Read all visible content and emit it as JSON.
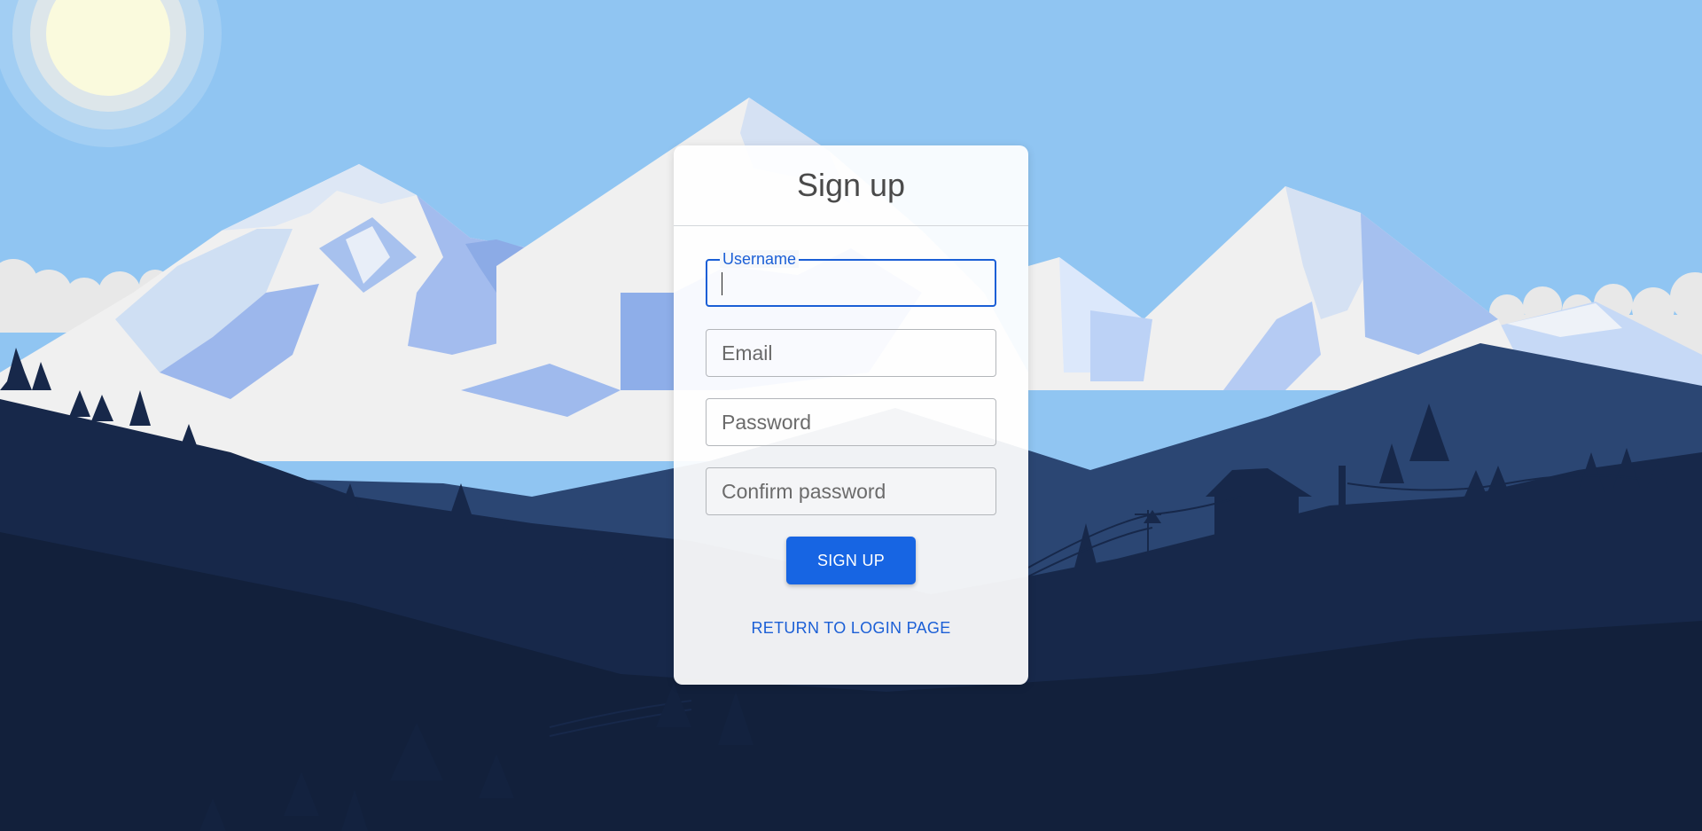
{
  "page": {
    "title": "Sign up"
  },
  "form": {
    "username": {
      "label": "Username",
      "value": "",
      "focused": true
    },
    "email": {
      "placeholder": "Email",
      "value": ""
    },
    "password": {
      "placeholder": "Password",
      "value": ""
    },
    "confirm_password": {
      "placeholder": "Confirm password",
      "value": ""
    },
    "submit_label": "SIGN UP",
    "return_link_label": "RETURN TO LOGIN PAGE"
  },
  "colors": {
    "sky": "#90c5f2",
    "accent": "#1765e3",
    "link": "#1b5fd6",
    "forest_dark": "#12203b"
  }
}
